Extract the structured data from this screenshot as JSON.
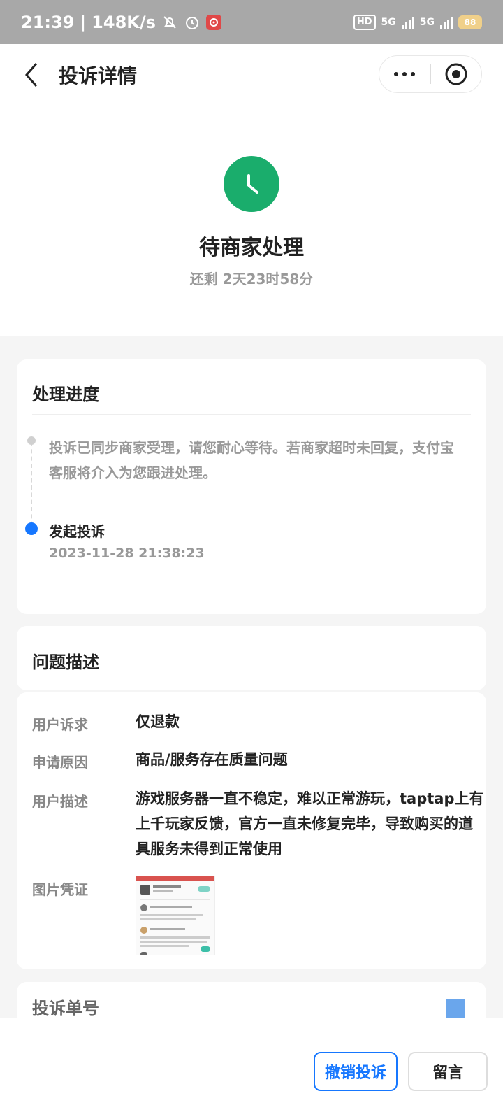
{
  "status_bar": {
    "time": "21:39",
    "separator": "|",
    "net_speed": "148K/s",
    "hd_label": "HD",
    "signal1_label": "5G",
    "signal2_label": "5G",
    "battery": "88"
  },
  "nav": {
    "title": "投诉详情"
  },
  "status": {
    "title": "待商家处理",
    "remaining": "还剩 2天23时58分",
    "accent_color": "#1aad6c"
  },
  "progress": {
    "title": "处理进度",
    "entries": [
      {
        "text": "投诉已同步商家受理，请您耐心等待。若商家超时未回复，支付宝客服将介入为您跟进处理。"
      },
      {
        "title": "发起投诉",
        "time": "2023-11-28 21:38:23"
      }
    ]
  },
  "issue": {
    "title": "问题描述",
    "rows": [
      {
        "label": "用户诉求",
        "value": "仅退款"
      },
      {
        "label": "申请原因",
        "value": "商品/服务存在质量问题"
      },
      {
        "label": "用户描述",
        "value": "游戏服务器一直不稳定，难以正常游玩，taptap上有上千玩家反馈，官方一直未修复完毕，导致购买的道具服务未得到正常使用"
      },
      {
        "label": "图片凭证"
      }
    ]
  },
  "order": {
    "title": "投诉单号"
  },
  "actions": {
    "cancel": "撤销投诉",
    "message": "留言",
    "primary_color": "#1677ff"
  }
}
